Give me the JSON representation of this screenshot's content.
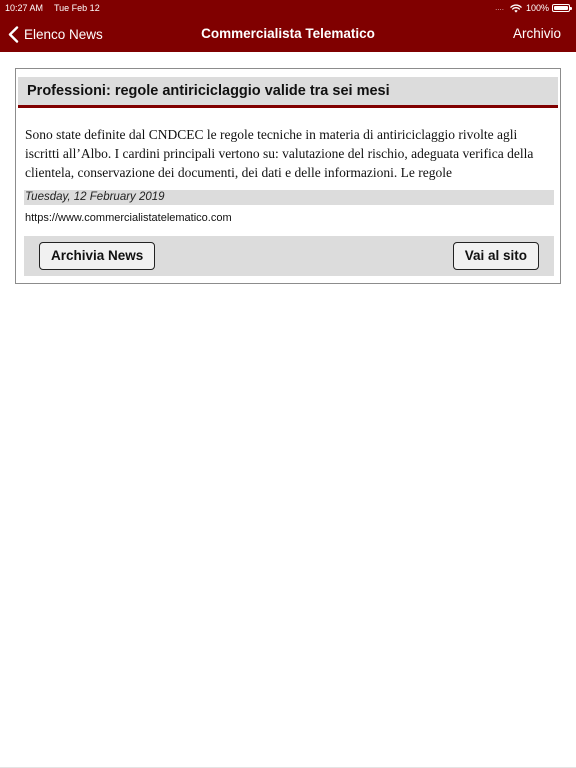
{
  "status_bar": {
    "time": "10:27 AM",
    "date": "Tue Feb 12",
    "signal": "....",
    "battery_percent": "100%",
    "battery_level": 1.0
  },
  "nav": {
    "back_label": "Elenco News",
    "title": "Commercialista Telematico",
    "right_label": "Archivio"
  },
  "article": {
    "title": "Professioni: regole antiriciclaggio valide tra sei mesi",
    "body": "Sono state definite dal CNDCEC le regole tecniche in materia di antiriciclaggio rivolte agli iscritti all’Albo. I cardini principali vertono su: valutazione del rischio, adeguata verifica della clientela, conservazione dei documenti, dei dati e delle informazioni. Le regole",
    "date": "Tuesday, 12 February 2019",
    "url": "https://www.commercialistatelematico.com"
  },
  "actions": {
    "archive_label": "Archivia News",
    "site_label": "Vai al sito"
  },
  "colors": {
    "brand": "#800000",
    "header_bg": "#dcdcdc"
  },
  "icons": {
    "back": "chevron-left-icon",
    "wifi": "wifi-icon",
    "battery": "battery-icon"
  }
}
